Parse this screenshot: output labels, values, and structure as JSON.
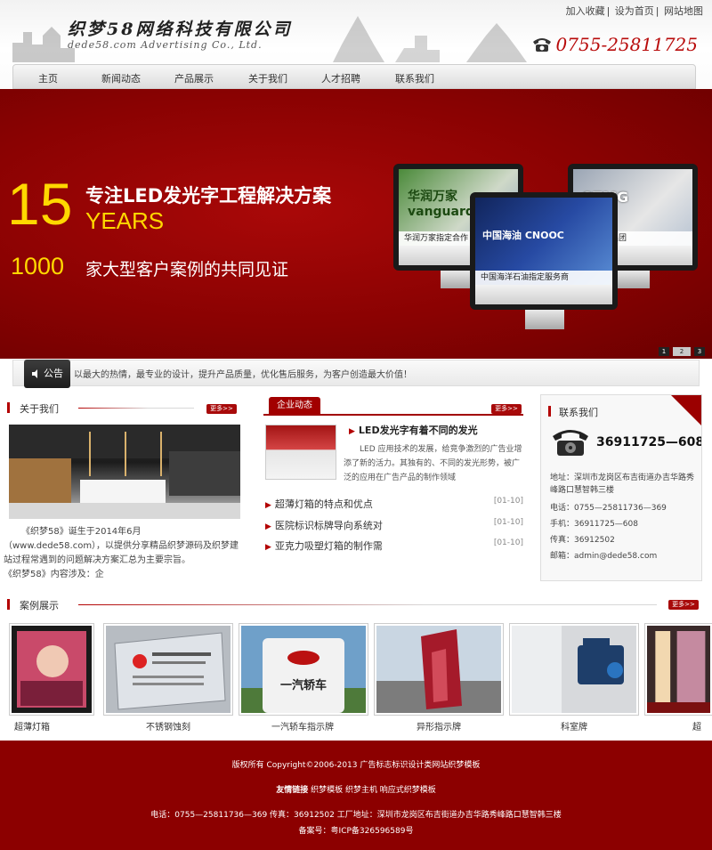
{
  "header": {
    "logo_cn": "织梦58网络科技有限公司",
    "logo_en": "dede58.com Advertising Co., Ltd.",
    "toplinks": [
      "加入收藏",
      "设为首页",
      "网站地图"
    ],
    "phone": "0755-25811725"
  },
  "nav": [
    "主页",
    "新闻动态",
    "产品展示",
    "关于我们",
    "人才招聘",
    "联系我们"
  ],
  "banner": {
    "num": "15",
    "title": "专注LED发光字工程解决方案",
    "years": "YEARS",
    "num2": "1000",
    "subtitle": "家大型客户案例的共同见证",
    "screens": [
      {
        "caption": "华润万家指定合作",
        "sign": "华润万家 vanguard"
      },
      {
        "caption": "中国海洋石油指定服务商",
        "sign": "中国海油 CNOOC"
      },
      {
        "caption": "深圳广电集团",
        "sign": "SZMG"
      }
    ],
    "pages": [
      "1",
      "2",
      "3"
    ],
    "active_page": 2
  },
  "notice": {
    "label": "公告",
    "text": "以最大的热情，最专业的设计，提升产品质量，优化售后服务，为客户创造最大价值！"
  },
  "about": {
    "title": "关于我们",
    "more": "更多>>",
    "text1": "《织梦58》诞生于2014年6月（www.dede58.com），以提供分享精品织梦源码及织梦建站过程常遇到的问题解决方案汇总为主要宗旨。",
    "text2": "《织梦58》内容涉及：企"
  },
  "news": {
    "tab": "企业动态",
    "more": "更多>>",
    "headline": "LED发光字有着不同的发光",
    "summary": "LED 应用技术的发展，给竞争激烈的广告业增添了新的活力。其独有的、不同的发光形势，被广泛的应用在广告产品的制作领域",
    "items": [
      {
        "title": "超薄灯箱的特点和优点",
        "date": "[01-10]"
      },
      {
        "title": "医院标识标牌导向系统对",
        "date": "[01-10]"
      },
      {
        "title": "亚克力吸塑灯箱的制作需",
        "date": "[01-10]"
      }
    ]
  },
  "contact": {
    "title": "联系我们",
    "tel_big": "36911725—608",
    "address": "地址：深圳市龙岗区布吉街道办吉华路秀峰路口慧智韩三楼",
    "phone": "电话：0755—25811736—369",
    "mobile": "手机：36911725—608",
    "fax": "传真：36912502",
    "email": "邮箱：admin@dede58.com"
  },
  "cases": {
    "title": "案例展示",
    "more": "更多>>",
    "items": [
      "超薄灯箱",
      "不锈钢蚀刻",
      "一汽轿车指示牌",
      "异形指示牌",
      "科室牌",
      "超"
    ],
    "sign_text": "一汽轿车"
  },
  "footer": {
    "copyright": "版权所有 Copyright©2006-2013 广告标志标识设计类网站织梦模板",
    "links_label": "友情链接",
    "links": "织梦模板 织梦主机 响应式织梦模板",
    "contact": "电话：0755—25811736—369  传真：36912502  工厂地址：深圳市龙岗区布吉街道办吉华路秀峰路口慧智韩三楼",
    "icp": "备案号：粤ICP备326596589号"
  }
}
